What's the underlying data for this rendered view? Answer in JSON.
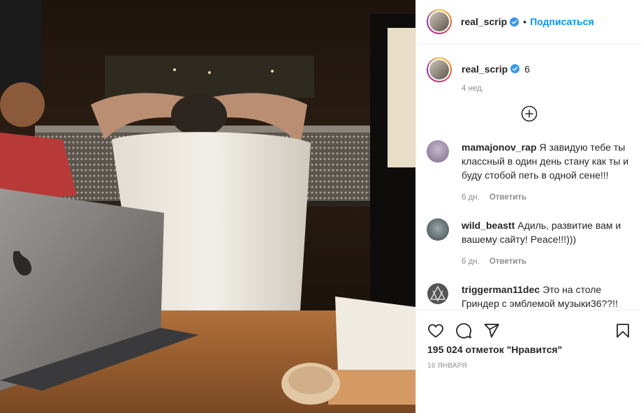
{
  "post": {
    "username": "real_scrip",
    "follow_label": "Подписаться",
    "dot": "•",
    "caption": "6",
    "caption_time": "4 нед.",
    "likes": "195 024 отметок \"Нравится\"",
    "date": "16 ЯНВАРЯ"
  },
  "comments": [
    {
      "username": "mamajonov_rap",
      "text": "Я завидую тебе ты классный в один день стану как ты и буду стобой петь в одной сене!!!",
      "time": "6 дн.",
      "reply": "Ответить"
    },
    {
      "username": "wild_beastt",
      "text": "Адиль, развитие вам и вашему сайту! Peace!!!)))",
      "time": "6 дн.",
      "reply": "Ответить"
    },
    {
      "username": "triggerman11dec",
      "text": "Это на столе Гриндер с эмблемой музыки36??!!",
      "time": "",
      "reply": ""
    }
  ],
  "icons": {
    "verified": "verified-badge-icon",
    "load_more": "plus-circle-icon",
    "like": "heart-icon",
    "comment": "comment-icon",
    "share": "paper-plane-icon",
    "save": "bookmark-icon"
  },
  "colors": {
    "accent": "#0095f6",
    "muted": "#8e8e8e",
    "text": "#262626"
  }
}
